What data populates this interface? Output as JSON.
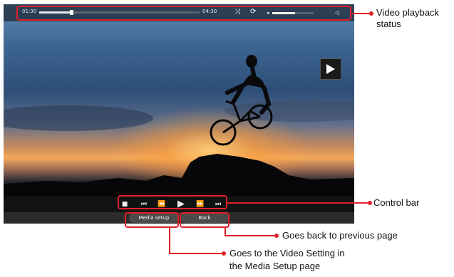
{
  "status": {
    "elapsed": "01:30",
    "total": "04:30",
    "progress_fraction": 0.2,
    "volume_fraction": 0.55,
    "icons": [
      "shuffle-icon",
      "repeat-icon",
      "volume-icon"
    ]
  },
  "overlay": {
    "icon": "play-icon"
  },
  "controls": {
    "icons": [
      "stop-icon",
      "previous-icon",
      "rewind-icon",
      "play-icon",
      "fast-forward-icon",
      "next-icon"
    ]
  },
  "buttons": {
    "media_setup": "Media setup",
    "back": "Back"
  },
  "annotations": {
    "status": "Video playback status",
    "control_bar": "Control bar",
    "back": "Goes back to previous page",
    "media_setup_line1": "Goes to the Video Setting in",
    "media_setup_line2": "the Media Setup page"
  },
  "colors": {
    "callout": "#e0202a"
  }
}
